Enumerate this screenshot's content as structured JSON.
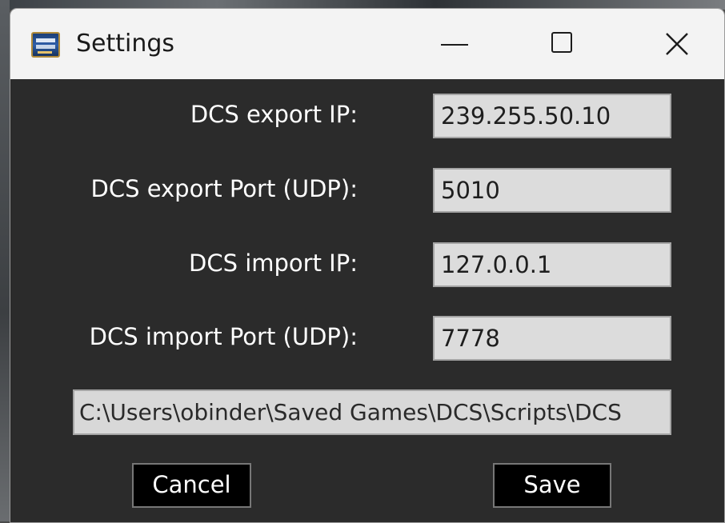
{
  "window": {
    "title": "Settings",
    "icon": "dcs-app-icon",
    "controls": [
      "minimize-icon",
      "maximize-icon",
      "close-icon"
    ]
  },
  "form": {
    "export_ip": {
      "label": "DCS export IP:",
      "value": "239.255.50.10"
    },
    "export_port": {
      "label": "DCS export Port (UDP):",
      "value": "5010"
    },
    "import_ip": {
      "label": "DCS import IP:",
      "value": "127.0.0.1"
    },
    "import_port": {
      "label": "DCS import Port (UDP):",
      "value": "7778"
    },
    "scripts_path": {
      "value": "C:\\Users\\obinder\\Saved Games\\DCS\\Scripts\\DCS"
    }
  },
  "buttons": {
    "cancel": "Cancel",
    "save": "Save"
  },
  "colors": {
    "window_bg": "#2b2b2b",
    "titlebar_bg": "#f3f3f3",
    "field_bg": "#dcdcdc",
    "button_bg": "#000000",
    "text_light": "#ffffff"
  }
}
